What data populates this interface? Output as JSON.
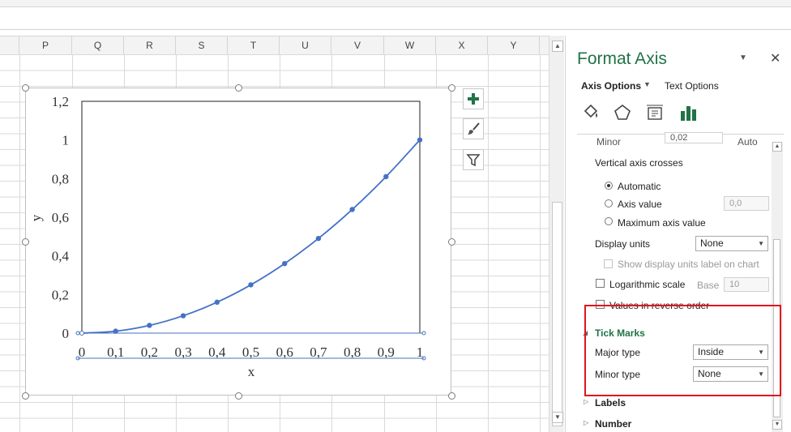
{
  "sheet": {
    "columns": [
      "P",
      "Q",
      "R",
      "S",
      "T",
      "U",
      "V",
      "W",
      "X",
      "Y"
    ]
  },
  "chart_data": {
    "type": "scatter",
    "x": [
      0,
      0.1,
      0.2,
      0.3,
      0.4,
      0.5,
      0.6,
      0.7,
      0.8,
      0.9,
      1
    ],
    "series": [
      {
        "values": [
          0,
          0.01,
          0.04,
          0.09,
          0.16,
          0.25,
          0.36,
          0.49,
          0.64,
          0.81,
          1
        ],
        "color": "#4472c4"
      }
    ],
    "xlabel": "x",
    "ylabel": "y",
    "xlim": [
      0,
      1
    ],
    "ylim": [
      0,
      1.2
    ],
    "x_ticks": [
      "0",
      "0,1",
      "0,2",
      "0,3",
      "0,4",
      "0,5",
      "0,6",
      "0,7",
      "0,8",
      "0,9",
      "1"
    ],
    "y_ticks": [
      "0",
      "0,2",
      "0,4",
      "0,6",
      "0,8",
      "1",
      "1,2"
    ],
    "grid": false,
    "smooth_line": true,
    "markers": true
  },
  "chart_side_buttons": [
    {
      "icon": "plus-icon"
    },
    {
      "icon": "brush-icon"
    },
    {
      "icon": "filter-icon"
    }
  ],
  "pane": {
    "title": "Format Axis",
    "tabs": {
      "axis_options": "Axis Options",
      "text_options": "Text Options"
    },
    "icons": [
      "paint-bucket-icon",
      "pentagon-icon",
      "size-properties-icon",
      "bar-chart-icon"
    ],
    "minor_label": "Minor",
    "minor_value": "0,02",
    "minor_auto": "Auto",
    "vertical_axis_crosses": "Vertical axis crosses",
    "radio_automatic": "Automatic",
    "radio_axis_value": "Axis value",
    "axis_value": "0,0",
    "radio_maximum": "Maximum axis value",
    "display_units_label": "Display units",
    "display_units_value": "None",
    "show_units_label": "Show display units label on chart",
    "log_scale_label": "Logarithmic scale",
    "base_label": "Base",
    "base_value": "10",
    "reverse_label": "Values in reverse order",
    "tick_marks": "Tick Marks",
    "major_type_label": "Major type",
    "major_type_value": "Inside",
    "minor_type_label": "Minor type",
    "minor_type_value": "None",
    "labels_section": "Labels",
    "number_section": "Number",
    "accent": "#217346",
    "highlight": "#e0141e"
  }
}
